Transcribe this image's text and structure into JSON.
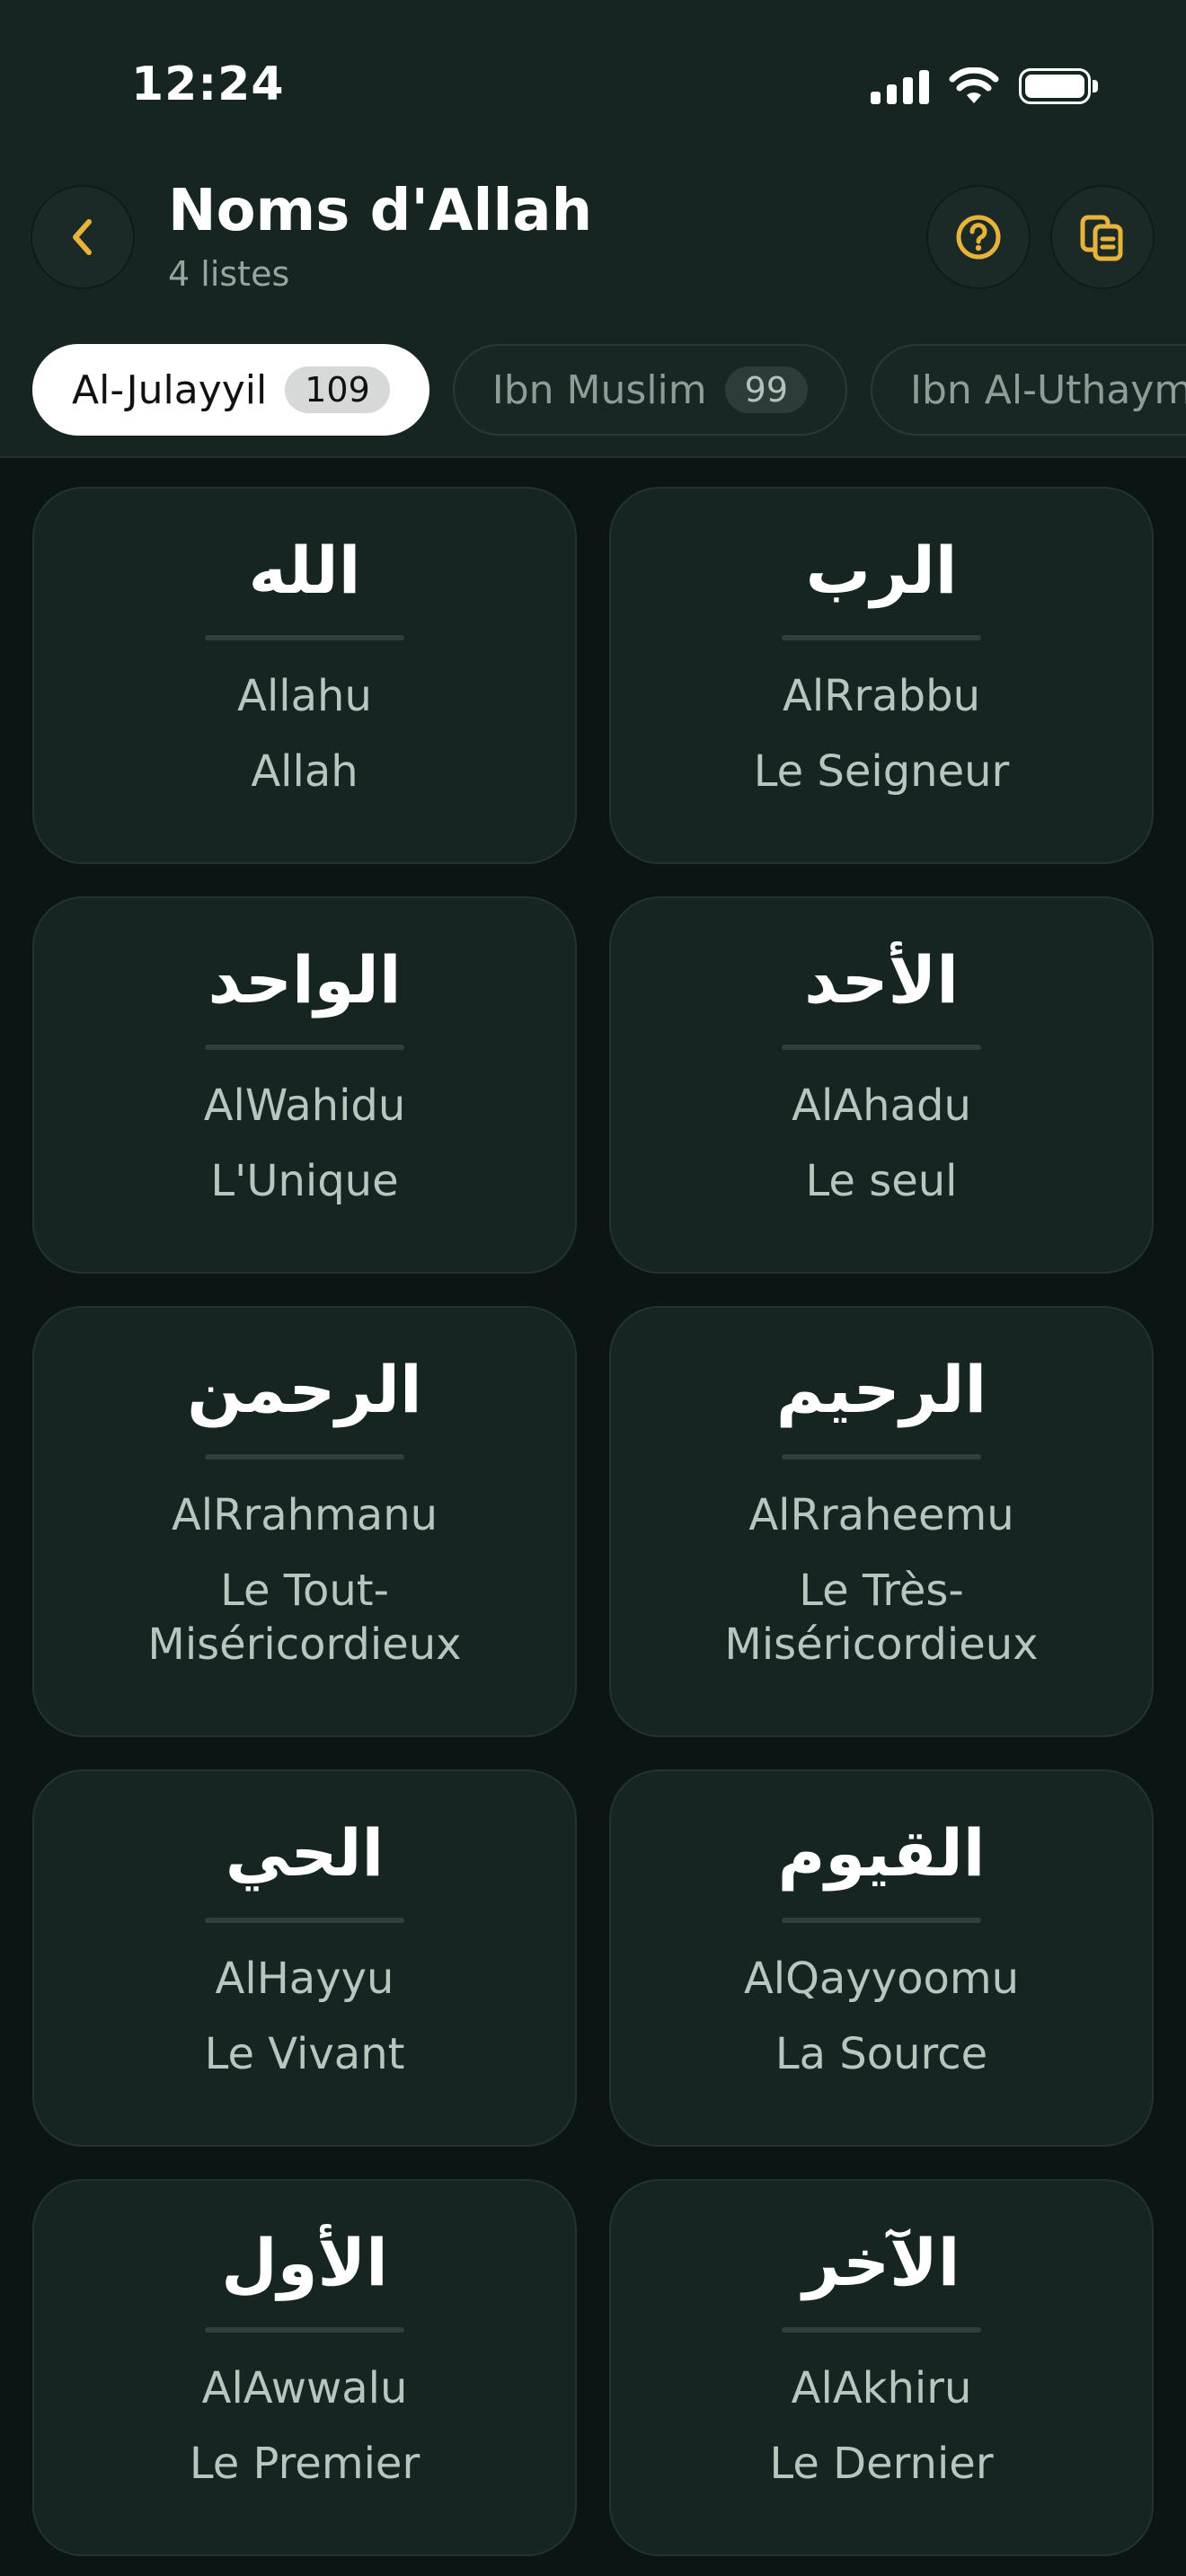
{
  "status": {
    "time": "12:24"
  },
  "header": {
    "title": "Noms d'Allah",
    "subtitle": "4 listes"
  },
  "icons": {
    "back": "chevron-left-icon",
    "help": "question-circle-icon",
    "copy": "copy-icon",
    "accent": "#e8b33a"
  },
  "tabs": [
    {
      "label": "Al-Julayyil",
      "count": "109"
    },
    {
      "label": "Ibn Muslim",
      "count": "99"
    },
    {
      "label": "Ibn Al-Uthaymi",
      "count": ""
    }
  ],
  "names": [
    {
      "arabic": "الله",
      "translit": "Allahu",
      "meaning": "Allah"
    },
    {
      "arabic": "الرب",
      "translit": "AlRrabbu",
      "meaning": "Le Seigneur"
    },
    {
      "arabic": "الواحد",
      "translit": "AlWahidu",
      "meaning": "L'Unique"
    },
    {
      "arabic": "الأحد",
      "translit": "AlAhadu",
      "meaning": "Le seul"
    },
    {
      "arabic": "الرحمن",
      "translit": "AlRrahmanu",
      "meaning": "Le Tout-Miséricordieux"
    },
    {
      "arabic": "الرحيم",
      "translit": "AlRraheemu",
      "meaning": "Le Très-Miséricordieux"
    },
    {
      "arabic": "الحي",
      "translit": "AlHayyu",
      "meaning": "Le Vivant"
    },
    {
      "arabic": "القيوم",
      "translit": "AlQayyoomu",
      "meaning": "La Source"
    },
    {
      "arabic": "الأول",
      "translit": "AlAwwalu",
      "meaning": "Le Premier"
    },
    {
      "arabic": "الآخر",
      "translit": "AlAkhiru",
      "meaning": "Le Dernier"
    }
  ]
}
